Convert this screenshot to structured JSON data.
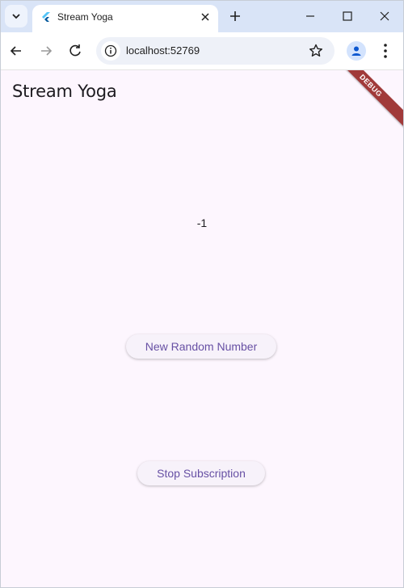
{
  "browser": {
    "tab_title": "Stream Yoga",
    "url": "localhost:52769"
  },
  "app": {
    "title": "Stream Yoga",
    "counter_value": "-1",
    "random_button_label": "New Random Number",
    "stop_button_label": "Stop Subscription",
    "debug_banner": "DEBUG"
  },
  "colors": {
    "app_background": "#fdf6fe",
    "button_text": "#6750a4",
    "titlebar": "#d9e4f7",
    "debug_ribbon": "#a13a3a"
  },
  "icons": {
    "tab_search": "chevron-down-icon",
    "favicon": "flutter-icon",
    "tab_close": "close-icon",
    "new_tab": "plus-icon",
    "back": "arrow-left-icon",
    "forward": "arrow-right-icon",
    "reload": "reload-icon",
    "site_info": "info-icon",
    "bookmark": "star-icon",
    "profile": "person-icon",
    "menu": "kebab-menu-icon"
  }
}
